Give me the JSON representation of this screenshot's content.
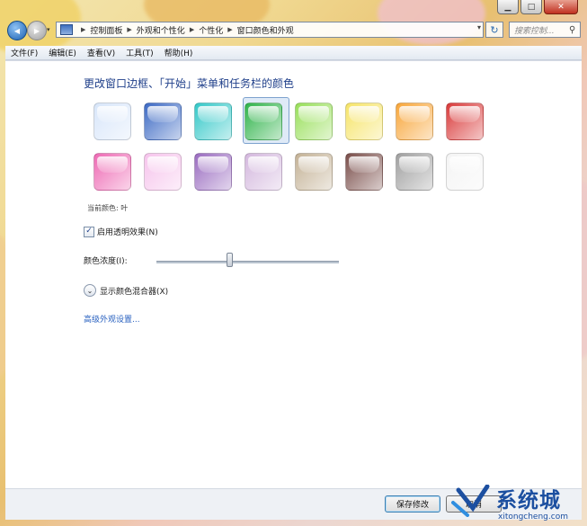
{
  "window": {
    "caption_buttons": {
      "minimize": "▁",
      "maximize": "□",
      "close": "✕"
    }
  },
  "navbar": {
    "back_icon": "back-arrow-icon",
    "back_glyph": "◀",
    "forward_glyph": "▶",
    "recent_glyph": "▾",
    "breadcrumb": [
      "控制面板",
      "外观和个性化",
      "个性化",
      "窗口颜色和外观"
    ],
    "crumb_separator": "▶",
    "address_dropdown": "▾",
    "refresh_glyph": "↻",
    "search_placeholder": "搜索控制...",
    "search_icon_glyph": "⚲"
  },
  "menubar": {
    "items": [
      "文件(F)",
      "编辑(E)",
      "查看(V)",
      "工具(T)",
      "帮助(H)"
    ]
  },
  "content": {
    "title": "更改窗口边框、「开始」菜单和任务栏的颜色",
    "swatches_row1": [
      {
        "name": "sky",
        "color": "#d8e6fa"
      },
      {
        "name": "twilight",
        "color": "#3d6ac4"
      },
      {
        "name": "sea",
        "color": "#34c8c8"
      },
      {
        "name": "leaf",
        "color": "#2fb34a",
        "selected": true
      },
      {
        "name": "lime",
        "color": "#98df5a"
      },
      {
        "name": "lemon",
        "color": "#f6e468"
      },
      {
        "name": "tangerine",
        "color": "#f8a63a"
      },
      {
        "name": "ruby",
        "color": "#d93a3a"
      }
    ],
    "swatches_row2": [
      {
        "name": "fuchsia",
        "color": "#ee6ab4"
      },
      {
        "name": "blush",
        "color": "#f6c4ec"
      },
      {
        "name": "violet",
        "color": "#9a6cc0"
      },
      {
        "name": "lavender",
        "color": "#d4b8de"
      },
      {
        "name": "taupe",
        "color": "#c4b296"
      },
      {
        "name": "chocolate",
        "color": "#7a4e4a"
      },
      {
        "name": "slate",
        "color": "#a0a0a0"
      },
      {
        "name": "frost",
        "color": "#f4f4f4"
      }
    ],
    "current_color": "当前颜色: 叶",
    "transparency_label": "启用透明效果(N)",
    "transparency_checked": true,
    "check_glyph": "✓",
    "intensity_label": "颜色浓度(I):",
    "intensity_value": 0.4,
    "mixer_label": "显示颜色混合器(X)",
    "mixer_glyph": "⌄",
    "advanced_link": "高级外观设置..."
  },
  "bottombar": {
    "save_label": "保存修改",
    "cancel_label": "取消"
  },
  "watermark": {
    "text": "系统城",
    "url": "xitongcheng.com"
  }
}
